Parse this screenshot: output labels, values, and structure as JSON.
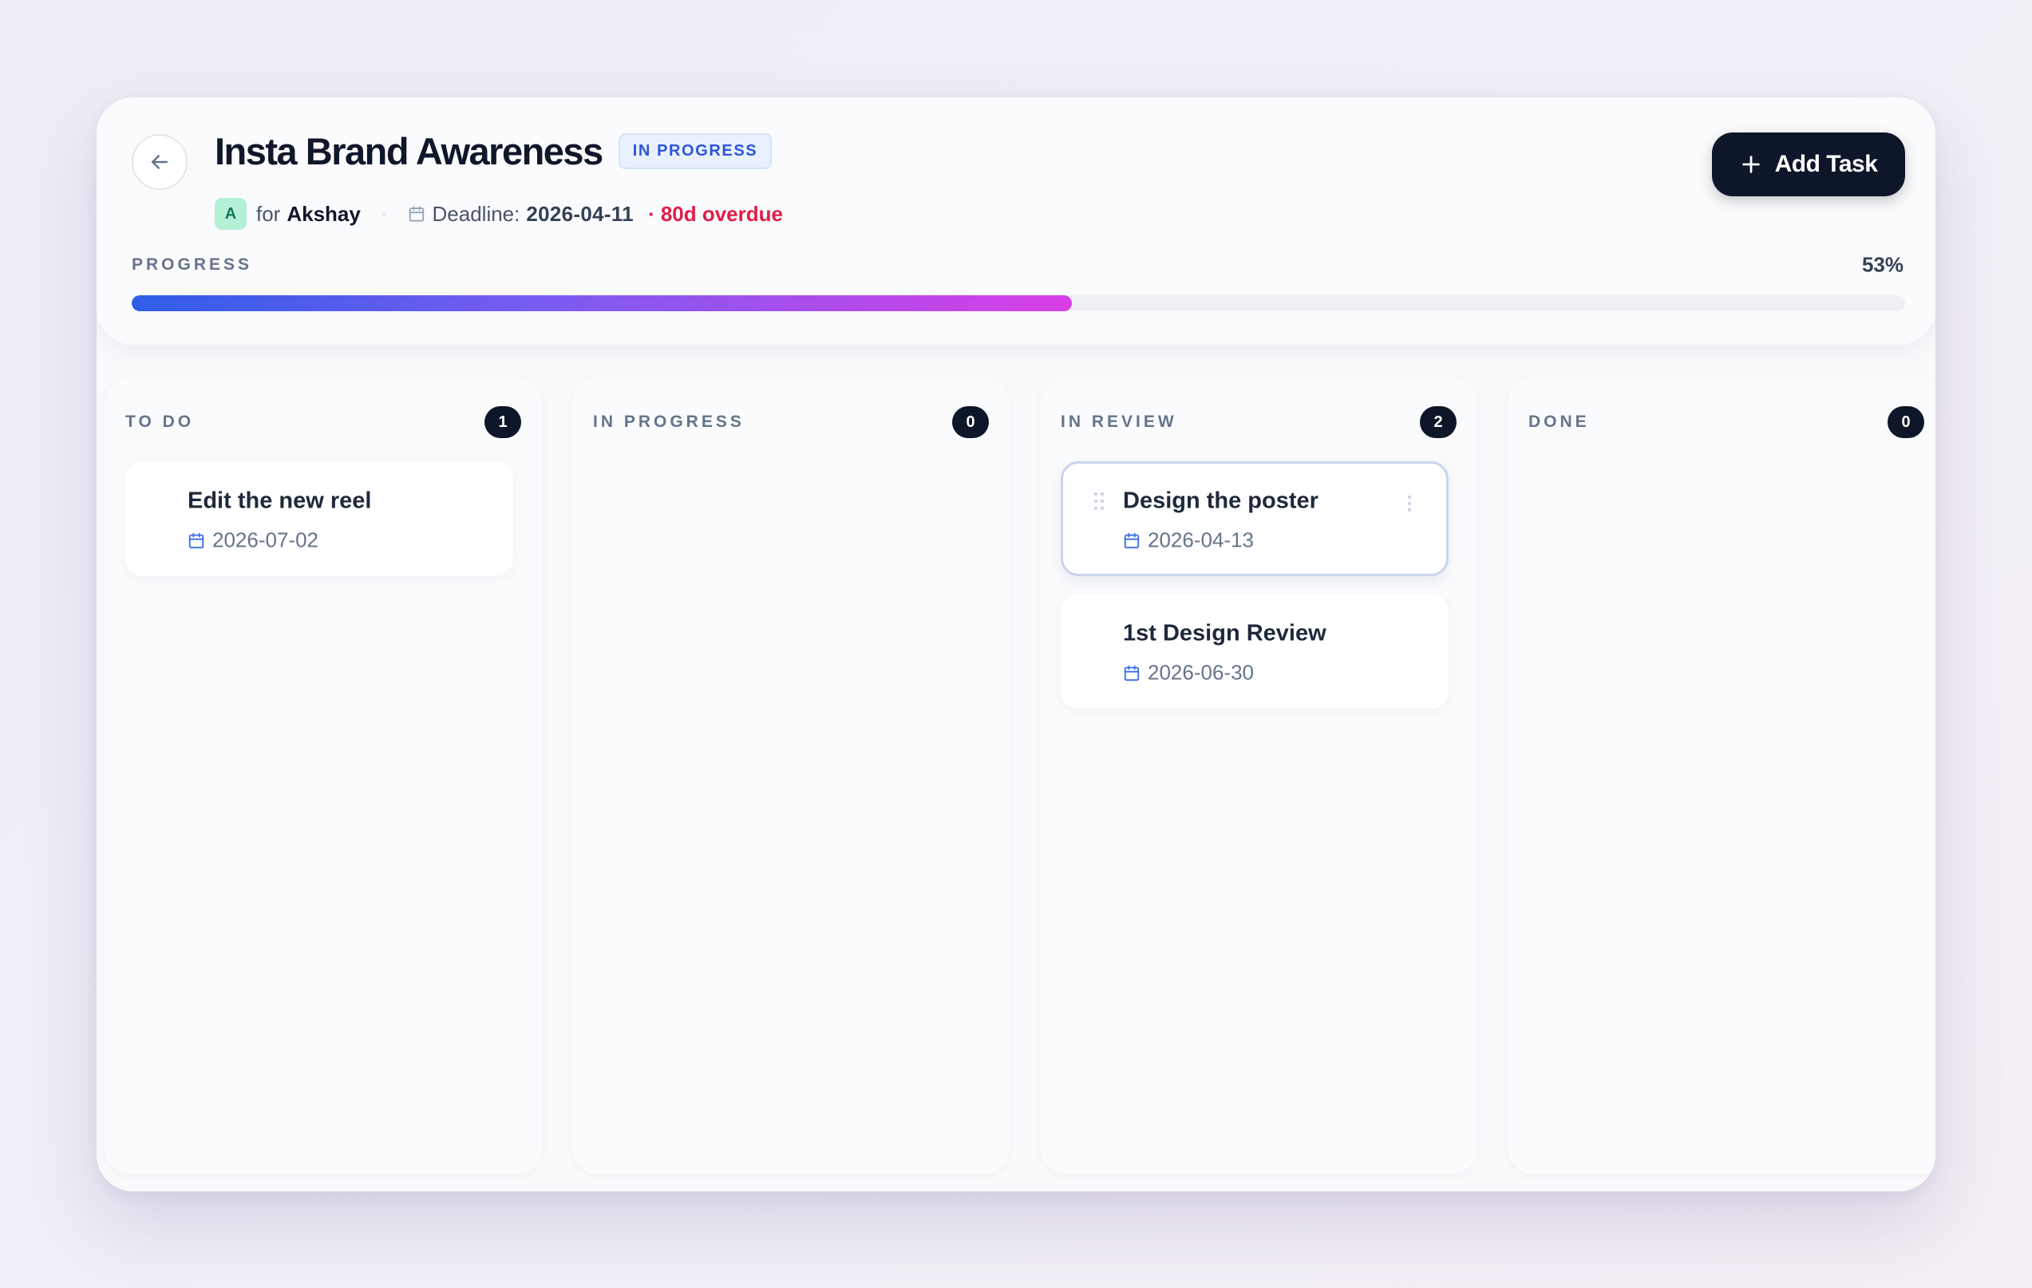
{
  "project": {
    "title": "Insta Brand Awareness",
    "status": "IN PROGRESS",
    "avatar_initial": "A",
    "owner_prefix": "for",
    "owner": "Akshay",
    "deadline_label": "Deadline:",
    "deadline": "2026-04-11",
    "overdue": "· 80d overdue"
  },
  "toolbar": {
    "add_task_label": "Add Task"
  },
  "progress": {
    "label": "PROGRESS",
    "value": 53,
    "percent_label": "53%"
  },
  "columns": [
    {
      "title": "TO DO",
      "count": "1",
      "cards": [
        {
          "title": "Edit the new reel",
          "date": "2026-07-02"
        }
      ]
    },
    {
      "title": "IN PROGRESS",
      "count": "0",
      "cards": []
    },
    {
      "title": "IN REVIEW",
      "count": "2",
      "cards": [
        {
          "title": "Design the poster",
          "date": "2026-04-13"
        },
        {
          "title": "1st Design Review",
          "date": "2026-06-30"
        }
      ]
    },
    {
      "title": "DONE",
      "count": "0",
      "cards": []
    }
  ],
  "colors": {
    "accent": "#0e1629",
    "status_badge": "#2c55d8",
    "overdue": "#e11d48",
    "progress_start": "#2f5de8",
    "progress_end": "#d83ee6"
  },
  "icons": {
    "back": "arrow-left-icon",
    "calendar": "calendar-icon",
    "add": "plus-icon",
    "drag": "drag-handle-icon",
    "menu": "more-vertical-icon"
  }
}
